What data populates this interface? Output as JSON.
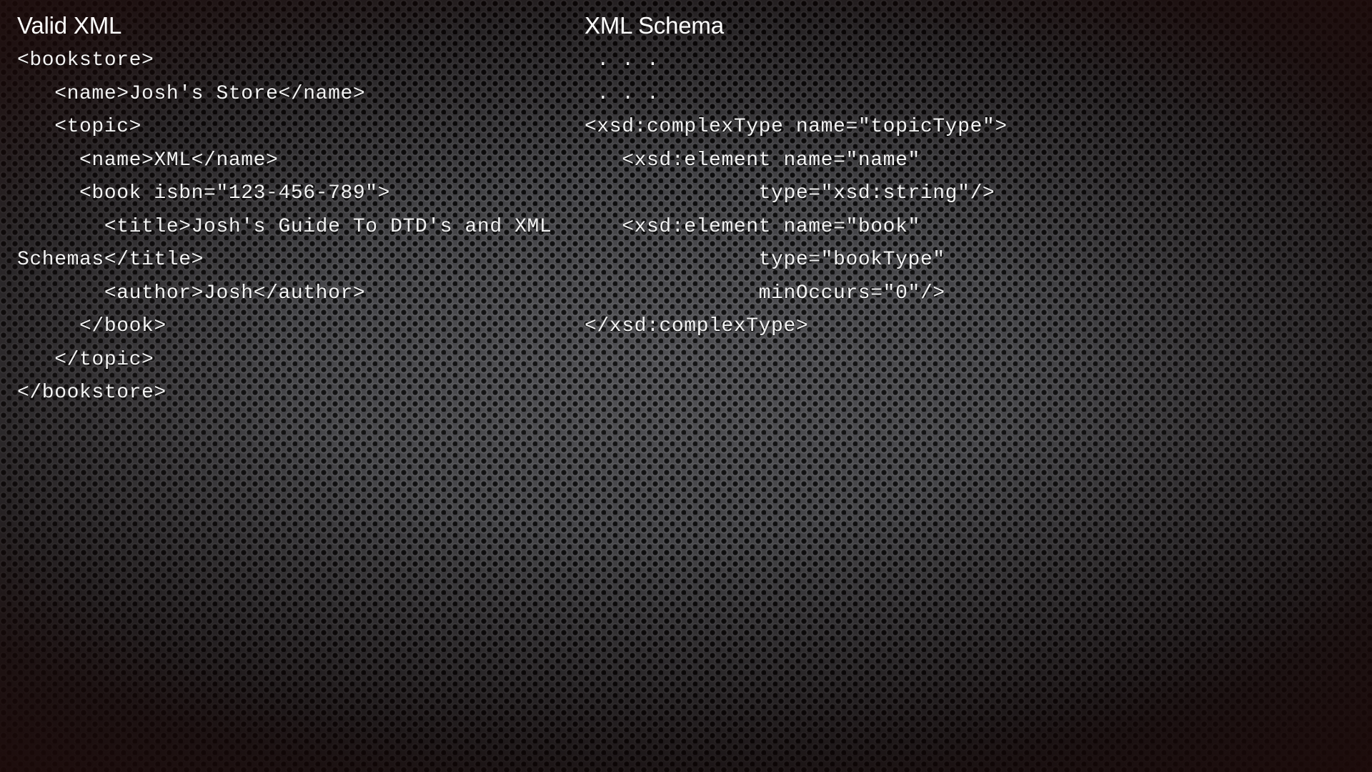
{
  "slide": {
    "background_color": "#46464a",
    "text_color": "#f3f3f3",
    "title_color": "#ffffff",
    "vignette_color": "#100606"
  },
  "panels": {
    "left": {
      "title": "Valid XML",
      "code_lines": [
        "<bookstore>",
        "   <name>Josh's Store</name>",
        "   <topic>",
        "     <name>XML</name>",
        "     <book isbn=\"123-456-789\">",
        "       <title>Josh's Guide To DTD's and XML Schemas</title>",
        "       <author>Josh</author>",
        "     </book>",
        "   </topic>",
        "</bookstore>"
      ],
      "code_text": "<bookstore>\n   <name>Josh's Store</name>\n   <topic>\n     <name>XML</name>\n     <book isbn=\"123-456-789\">\n       <title>Josh's Guide To DTD's and XML Schemas</title>\n       <author>Josh</author>\n     </book>\n   </topic>\n</bookstore>"
    },
    "right": {
      "title": "XML Schema",
      "code_lines": [
        " . . .",
        " . . .",
        "<xsd:complexType name=\"topicType\">",
        "   <xsd:element name=\"name\"",
        "              type=\"xsd:string\"/>",
        "   <xsd:element name=\"book\"",
        "              type=\"bookType\"",
        "              minOccurs=\"0\"/>",
        "</xsd:complexType>"
      ],
      "code_text": " . . .\n . . .\n<xsd:complexType name=\"topicType\">\n   <xsd:element name=\"name\"\n              type=\"xsd:string\"/>\n   <xsd:element name=\"book\"\n              type=\"bookType\"\n              minOccurs=\"0\"/>\n</xsd:complexType>"
    }
  }
}
